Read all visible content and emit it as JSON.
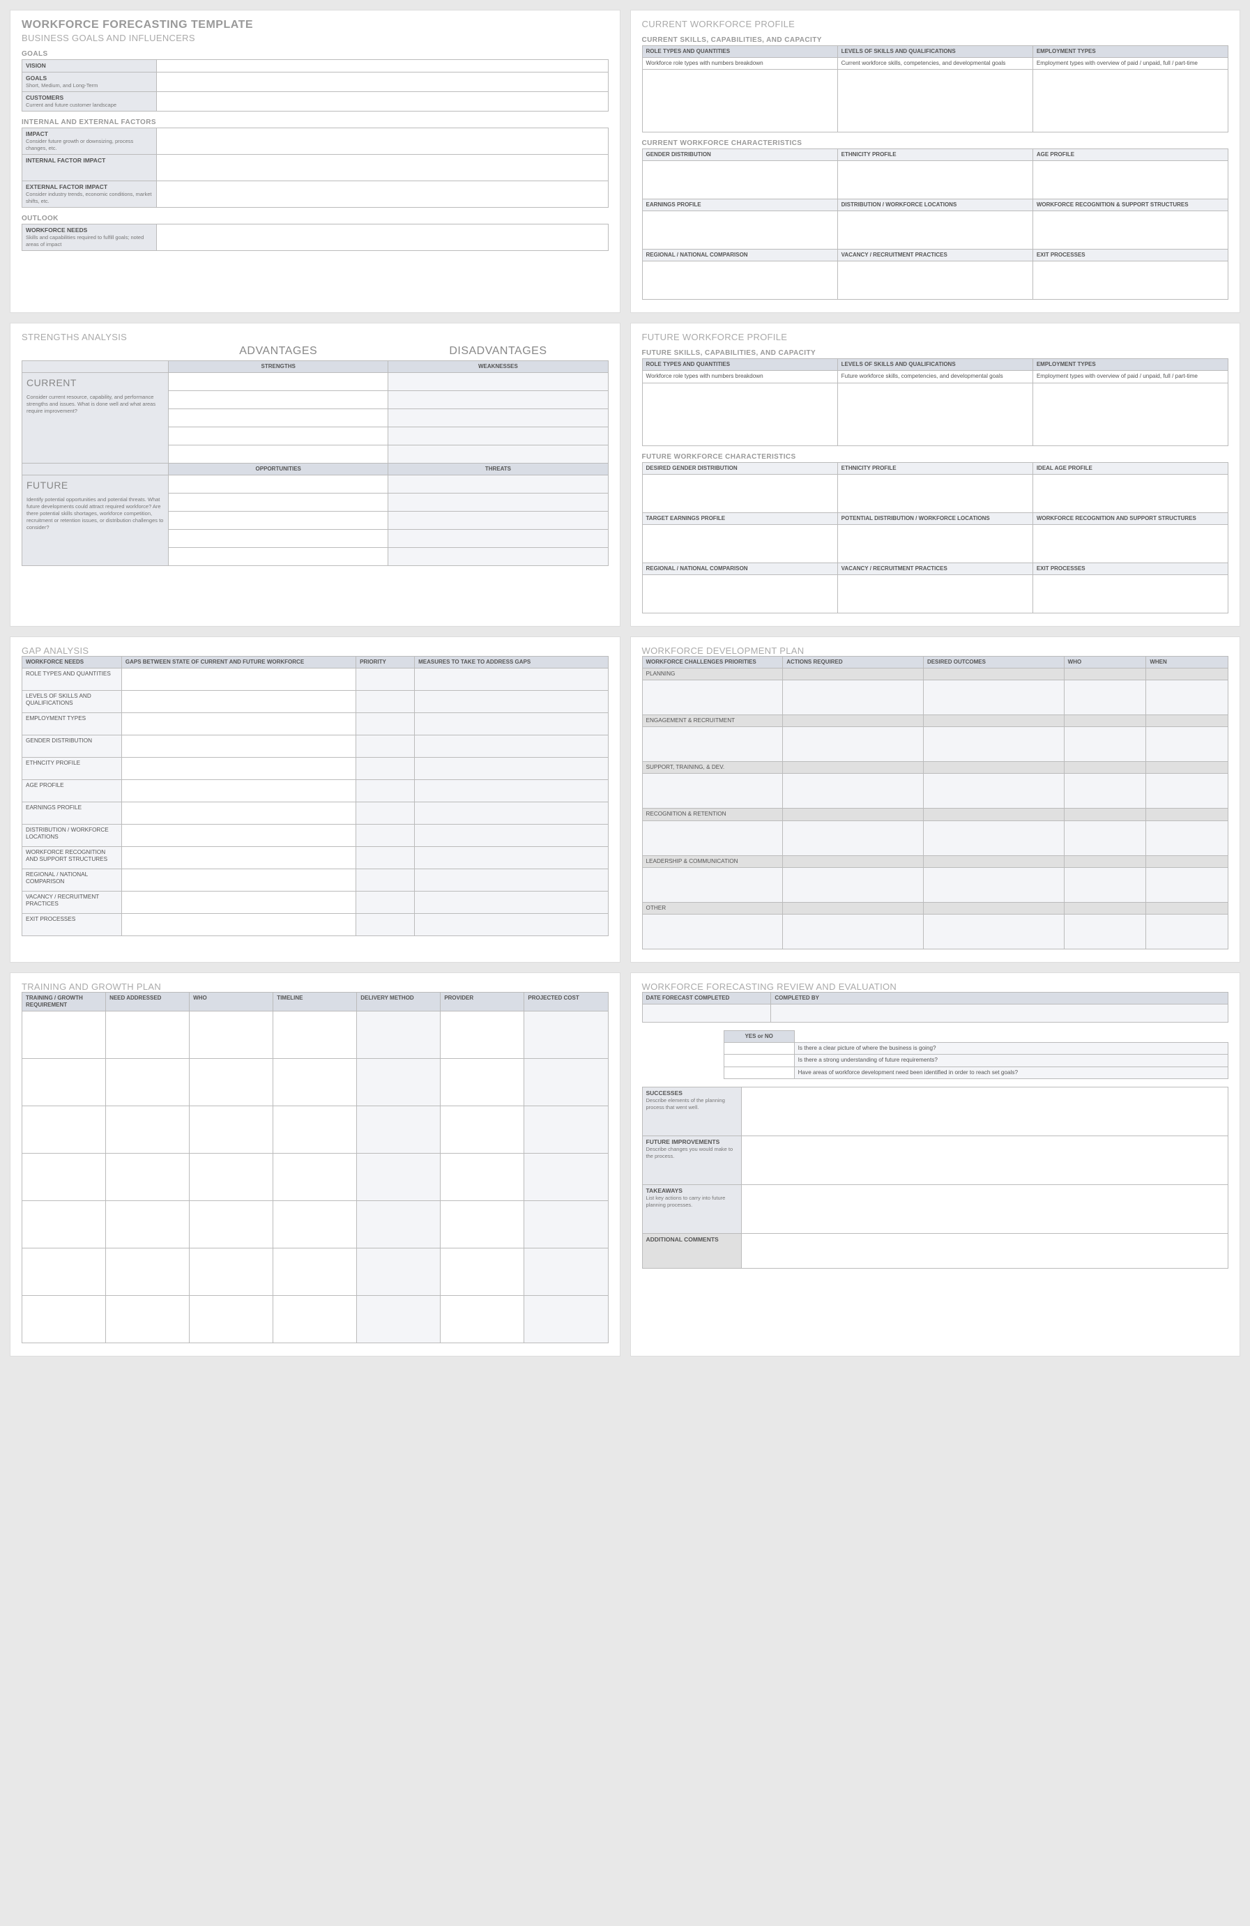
{
  "main_title": "WORKFORCE FORECASTING TEMPLATE",
  "business": {
    "title": "BUSINESS GOALS AND INFLUENCERS",
    "goals_h": "GOALS",
    "vision": "VISION",
    "goals": "GOALS",
    "goals_d": "Short, Medium, and Long-Term",
    "customers": "CUSTOMERS",
    "customers_d": "Current and future customer landscape",
    "factors_h": "INTERNAL AND EXTERNAL FACTORS",
    "impact": "IMPACT",
    "impact_d": "Consider future growth or downsizing, process changes, etc.",
    "internal": "INTERNAL FACTOR IMPACT",
    "external": "EXTERNAL FACTOR IMPACT",
    "external_d": "Consider industry trends, economic conditions, market shifts, etc.",
    "outlook_h": "OUTLOOK",
    "wneeds": "WORKFORCE NEEDS",
    "wneeds_d": "Skills and capabilities required to fulfill goals; noted areas of impact"
  },
  "cwp": {
    "title": "CURRENT WORKFORCE PROFILE",
    "skills_h": "CURRENT SKILLS, CAPABILITIES, AND CAPACITY",
    "c1": "ROLE TYPES AND QUANTITIES",
    "c2": "LEVELS OF SKILLS AND QUALIFICATIONS",
    "c3": "EMPLOYMENT TYPES",
    "r1": "Workforce role types with numbers breakdown",
    "r2": "Current workforce skills, competencies, and developmental goals",
    "r3": "Employment types with overview of paid / unpaid, full / part-time",
    "char_h": "CURRENT WORKFORCE CHARACTERISTICS",
    "gd": "GENDER DISTRIBUTION",
    "ep": "ETHNICITY PROFILE",
    "ap": "AGE PROFILE",
    "earn": "EARNINGS PROFILE",
    "dist": "DISTRIBUTION / WORKFORCE LOCATIONS",
    "rec": "WORKFORCE RECOGNITION & SUPPORT STRUCTURES",
    "reg": "REGIONAL / NATIONAL COMPARISON",
    "vac": "VACANCY / RECRUITMENT PRACTICES",
    "exit": "EXIT PROCESSES"
  },
  "swot": {
    "title": "STRENGTHS ANALYSIS",
    "adv": "ADVANTAGES",
    "dis": "DISADVANTAGES",
    "str": "STRENGTHS",
    "wea": "WEAKNESSES",
    "opp": "OPPORTUNITIES",
    "thr": "THREATS",
    "cur": "CURRENT",
    "cur_d": "Consider current resource, capability, and performance strengths and issues.  What is done well and what areas require improvement?",
    "fut": "FUTURE",
    "fut_d": "Identify potential opportunities and potential threats. What future developments could attract required workforce?  Are there potential skills shortages, workforce competition, recruitment or retention issues, or distribution challenges to consider?"
  },
  "fwp": {
    "title": "FUTURE WORKFORCE PROFILE",
    "skills_h": "FUTURE SKILLS, CAPABILITIES, AND CAPACITY",
    "c1": "ROLE TYPES AND QUANTITIES",
    "c2": "LEVELS OF SKILLS AND QUALIFICATIONS",
    "c3": "EMPLOYMENT TYPES",
    "r1": "Workforce role types with numbers breakdown",
    "r2": "Future workforce skills, competencies, and developmental goals",
    "r3": "Employment types with overview of paid / unpaid, full / part-time",
    "char_h": "FUTURE WORKFORCE CHARACTERISTICS",
    "gd": "DESIRED GENDER DISTRIBUTION",
    "ep": "ETHNICITY PROFILE",
    "ap": "IDEAL AGE PROFILE",
    "earn": "TARGET EARNINGS PROFILE",
    "dist": "POTENTIAL DISTRIBUTION / WORKFORCE LOCATIONS",
    "rec": "WORKFORCE RECOGNITION AND SUPPORT STRUCTURES",
    "reg": "REGIONAL / NATIONAL COMPARISON",
    "vac": "VACANCY / RECRUITMENT PRACTICES",
    "exit": "EXIT PROCESSES"
  },
  "gap": {
    "title": "GAP ANALYSIS",
    "c1": "WORKFORCE NEEDS",
    "c2": "GAPS BETWEEN STATE OF CURRENT AND FUTURE WORKFORCE",
    "c3": "PRIORITY",
    "c4": "MEASURES TO TAKE TO ADDRESS GAPS",
    "rows": [
      "ROLE TYPES AND QUANTITIES",
      "LEVELS OF SKILLS AND QUALIFICATIONS",
      "EMPLOYMENT TYPES",
      "GENDER DISTRIBUTION",
      "ETHNCITY PROFILE",
      "AGE PROFILE",
      "EARNINGS PROFILE",
      "DISTRIBUTION / WORKFORCE LOCATIONS",
      "WORKFORCE RECOGNITION AND SUPPORT STRUCTURES",
      "REGIONAL / NATIONAL COMPARISON",
      "VACANCY / RECRUITMENT PRACTICES",
      "EXIT PROCESSES"
    ]
  },
  "wdp": {
    "title": "WORKFORCE DEVELOPMENT PLAN",
    "c1": "WORKFORCE CHALLENGES PRIORITIES",
    "c2": "ACTIONS REQUIRED",
    "c3": "DESIRED OUTCOMES",
    "c4": "WHO",
    "c5": "WHEN",
    "groups": [
      "PLANNING",
      "ENGAGEMENT & RECRUITMENT",
      "SUPPORT, TRAINING, & DEV.",
      "RECOGNITION & RETENTION",
      "LEADERSHIP & COMMUNICATION",
      "OTHER"
    ]
  },
  "tgp": {
    "title": "TRAINING AND GROWTH PLAN",
    "c1": "TRAINING / GROWTH REQUIREMENT",
    "c2": "NEED ADDRESSED",
    "c3": "WHO",
    "c4": "TIMELINE",
    "c5": "DELIVERY METHOD",
    "c6": "PROVIDER",
    "c7": "PROJECTED COST"
  },
  "rev": {
    "title": "WORKFORCE FORECASTING REVIEW AND EVALUATION",
    "dfc": "DATE FORECAST COMPLETED",
    "cb": "COMPLETED BY",
    "yn": "YES or NO",
    "q1": "Is there a clear picture of where the business is going?",
    "q2": "Is there a strong understanding of future requirements?",
    "q3": "Have areas of workforce development need been identified in order to reach set goals?",
    "s1": "SUCCESSES",
    "s1d": "Describe elements of the planning process that went well.",
    "s2": "FUTURE IMPROVEMENTS",
    "s2d": "Describe changes you would make to the process.",
    "s3": "TAKEAWAYS",
    "s3d": "List key actions to carry into future planning processes.",
    "s4": "ADDITIONAL COMMENTS"
  }
}
